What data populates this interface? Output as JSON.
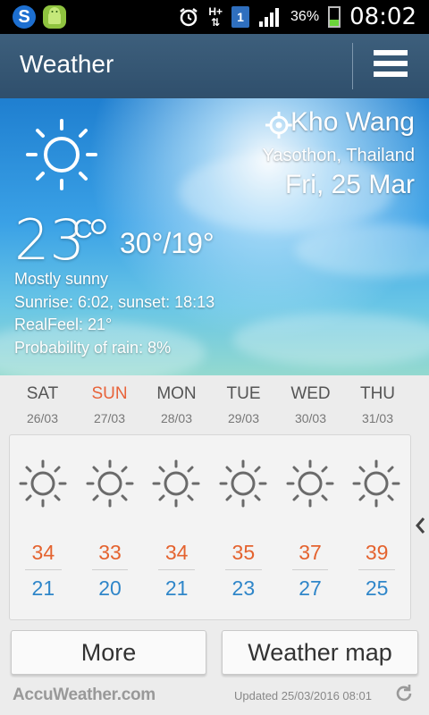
{
  "status_bar": {
    "time": "08:02",
    "battery_percent": "36%",
    "battery_level": 0.36,
    "network_type": "H+",
    "notification_count": "1",
    "icons": [
      "s-app-icon",
      "android-app-icon",
      "alarm-icon",
      "network-arrows-icon",
      "notification-icon",
      "signal-icon",
      "battery-icon"
    ]
  },
  "app_bar": {
    "title": "Weather",
    "menu_icon": "hamburger-menu-icon"
  },
  "current": {
    "location": "Kho Wang",
    "region": "Yasothon, Thailand",
    "date": "Fri, 25 Mar",
    "temperature": "23°",
    "unit": "C",
    "high_low": "30°/19°",
    "condition": "Mostly sunny",
    "sunrise_sunset": "Sunrise: 6:02, sunset: 18:13",
    "realfeel": "RealFeel: 21°",
    "rain_probability": "Probability of rain: 8%",
    "icon": "sun-icon",
    "location_icon": "current-location-icon"
  },
  "forecast": [
    {
      "day": "SAT",
      "date": "26/03",
      "high": "34",
      "low": "21",
      "icon": "sun-icon",
      "today": false
    },
    {
      "day": "SUN",
      "date": "27/03",
      "high": "33",
      "low": "20",
      "icon": "sun-icon",
      "today": true
    },
    {
      "day": "MON",
      "date": "28/03",
      "high": "34",
      "low": "21",
      "icon": "sun-icon",
      "today": false
    },
    {
      "day": "TUE",
      "date": "29/03",
      "high": "35",
      "low": "23",
      "icon": "sun-icon",
      "today": false
    },
    {
      "day": "WED",
      "date": "30/03",
      "high": "37",
      "low": "27",
      "icon": "sun-icon",
      "today": false
    },
    {
      "day": "THU",
      "date": "31/03",
      "high": "39",
      "low": "25",
      "icon": "sun-icon",
      "today": false
    }
  ],
  "buttons": {
    "more": "More",
    "weather_map": "Weather map"
  },
  "footer": {
    "brand": "AccuWeather.com",
    "updated": "Updated 25/03/2016 08:01",
    "refresh_icon": "refresh-icon"
  },
  "colors": {
    "high_temp": "#e4632f",
    "low_temp": "#2f86c9",
    "today_label": "#e8633a",
    "app_bar": "#3d5f7c"
  }
}
